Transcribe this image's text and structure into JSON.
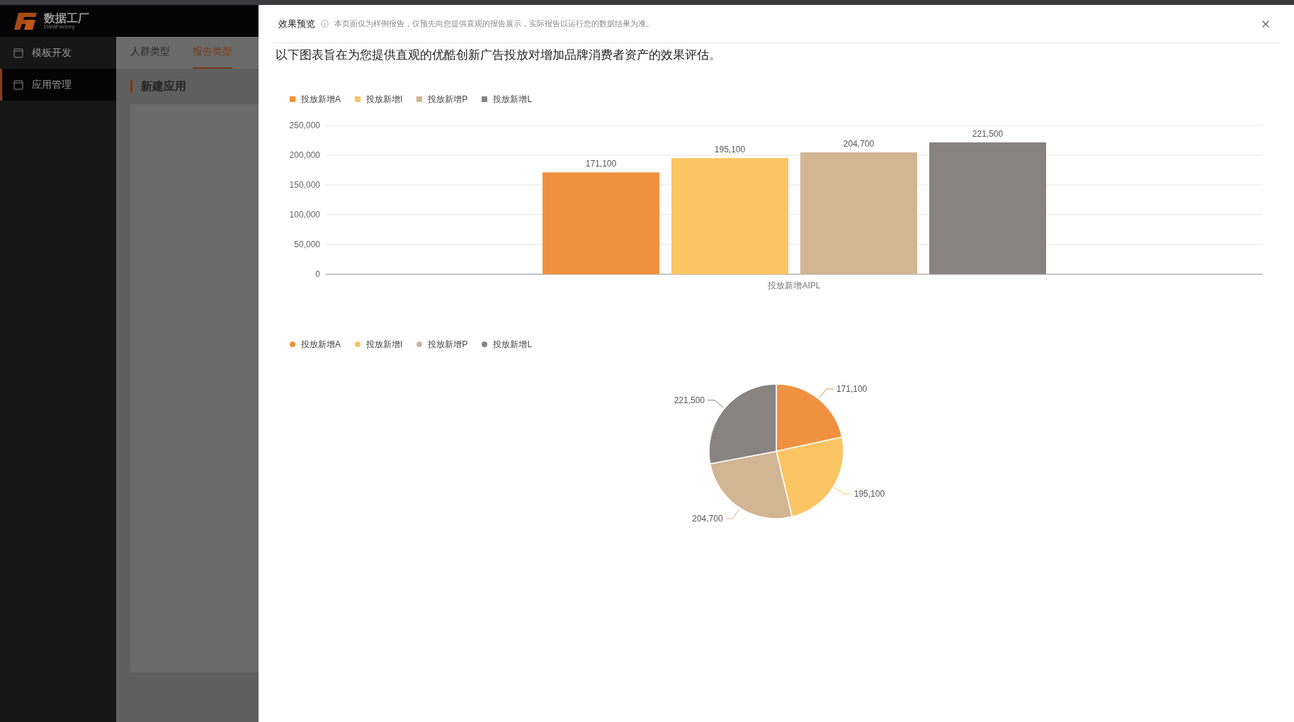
{
  "logo": {
    "title": "数据工厂",
    "subtitle": "DataFactory"
  },
  "sidebar": {
    "items": [
      {
        "label": "模板开发",
        "selected": false
      },
      {
        "label": "应用管理",
        "selected": true
      }
    ]
  },
  "background_page": {
    "tabs": [
      {
        "label": "人群类型",
        "selected": false
      },
      {
        "label": "报告类型",
        "selected": true
      }
    ],
    "section_title": "新建应用"
  },
  "modal": {
    "title": "效果预览",
    "note": "本页面仅为样例报告，仅预先向您提供直观的报告展示，实际报告以运行您的数据结果为准。",
    "intro": "以下图表旨在为您提供直观的优酷创新广告投放对增加品牌消费者资产的效果评估。",
    "bar_chart": {
      "chart_data": {
        "type": "bar",
        "categories": [
          "投放新增AIPL"
        ],
        "series": [
          {
            "name": "投放新增A",
            "color": "#f0913f",
            "values": [
              171100
            ]
          },
          {
            "name": "投放新增I",
            "color": "#fbc463",
            "values": [
              195100
            ]
          },
          {
            "name": "投放新增P",
            "color": "#d2b593",
            "values": [
              204700
            ]
          },
          {
            "name": "投放新增L",
            "color": "#888380",
            "values": [
              221500
            ]
          }
        ],
        "grid": true,
        "ylim": [
          0,
          250000
        ],
        "yticks": [
          {
            "value": 0,
            "label": "0"
          },
          {
            "value": 50000,
            "label": "50,000"
          },
          {
            "value": 100000,
            "label": "100,000"
          },
          {
            "value": 150000,
            "label": "150,000"
          },
          {
            "value": 200000,
            "label": "200,000"
          },
          {
            "value": 250000,
            "label": "250,000"
          }
        ],
        "value_labels": [
          "171,100",
          "195,100",
          "204,700",
          "221,500"
        ]
      }
    },
    "pie_chart": {
      "chart_data": {
        "type": "pie",
        "categories": [
          "投放新增A",
          "投放新增I",
          "投放新增P",
          "投放新增L"
        ],
        "values": [
          171100,
          195100,
          204700,
          221500
        ],
        "colors": [
          "#f0913f",
          "#fbc463",
          "#d2b593",
          "#888380"
        ],
        "value_labels": [
          "171,100",
          "195,100",
          "204,700",
          "221,500"
        ]
      }
    }
  }
}
